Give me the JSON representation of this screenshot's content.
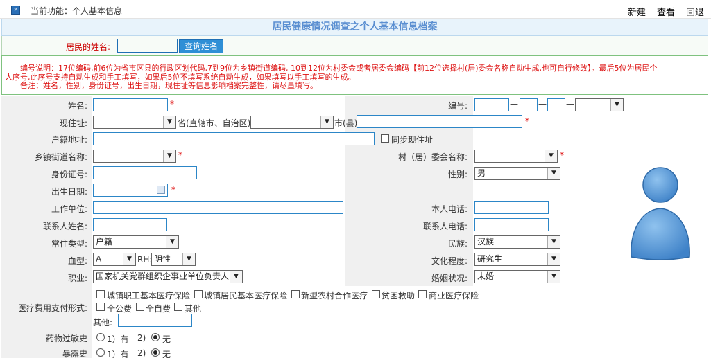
{
  "topbar": {
    "current_function": "当前功能：个人基本信息",
    "new_label": "新建",
    "view_label": "查看",
    "back_label": "回退"
  },
  "title": "居民健康情况调查之个人基本信息档案",
  "search": {
    "label": "居民的姓名:",
    "name_value": "",
    "button_label": "查询姓名"
  },
  "note": {
    "line1": "编号说明：17位编码,前6位为省市区县的行政区划代码,7到9位为乡镇街道编码, 10到12位为村委会或者居委会编码【前12位选择村(居)委会名称自动生成,也可自行修改】。最后5位为居民个",
    "line2": "人序号,此序号支持自动生成和手工填写，如果后5位不填写系统自动生成，如果填写以手工填写的生成。",
    "line3": "备注：姓名，性别，身份证号，出生日期，现住址等信息影响档案完整性，请尽量填写。"
  },
  "form": {
    "name_label": "姓名:",
    "code_label": "编号:",
    "address_label": "现住址:",
    "province_suffix": "省(直辖市、自治区)",
    "city_suffix": "市(县)",
    "huji_label": "户籍地址:",
    "sync_label": "同步现住址",
    "township_label": "乡镇街道名称:",
    "village_label": "村（居）委会名称:",
    "idcard_label": "身份证号:",
    "gender_label": "性别:",
    "gender_value": "男",
    "birth_label": "出生日期:",
    "work_label": "工作单位:",
    "phone_label": "本人电话:",
    "contact_name_label": "联系人姓名:",
    "contact_phone_label": "联系人电话:",
    "residence_type_label": "常住类型:",
    "residence_type_value": "户籍",
    "ethnicity_label": "民族:",
    "ethnicity_value": "汉族",
    "blood_label": "血型:",
    "blood_value": "A",
    "rh_label": "RH:",
    "rh_value": "阴性",
    "education_label": "文化程度:",
    "education_value": "研究生",
    "job_label": "职业:",
    "job_value": "国家机关党群组织企事业单位负责人",
    "marital_label": "婚姻状况:",
    "marital_value": "未婚",
    "payment_label": "医疗费用支付形式:",
    "payment_options_row1": [
      "城镇职工基本医疗保险",
      "城镇居民基本医疗保险",
      "新型农村合作医疗",
      "贫困救助",
      "商业医疗保险"
    ],
    "payment_options_row2": [
      "全公费",
      "全自费",
      "其他"
    ],
    "other_label": "其他:",
    "allergy_label": "药物过敏史",
    "exposure_label": "暴露史",
    "opt1_label": "1）有",
    "opt2_num": "2)",
    "opt2_label": "无",
    "dash": "—"
  }
}
